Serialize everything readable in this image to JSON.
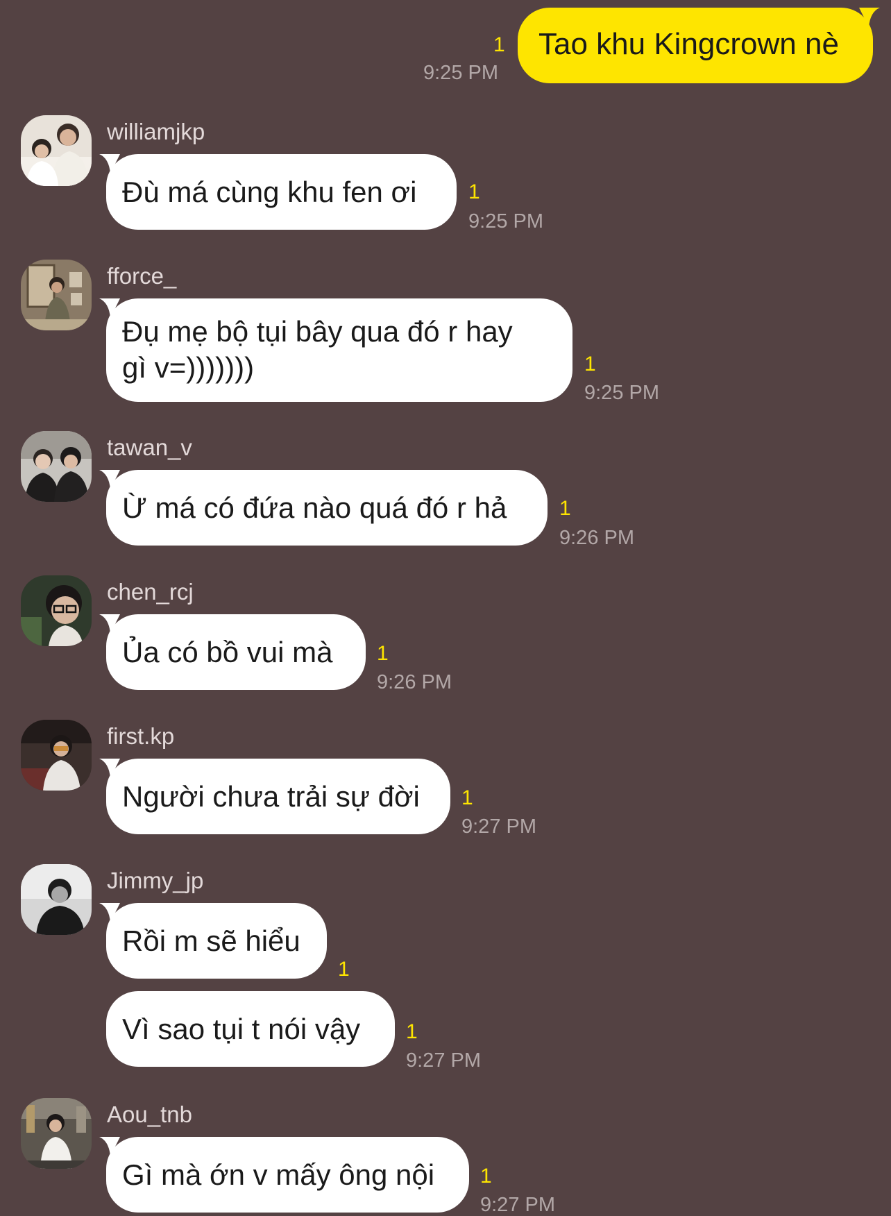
{
  "outgoing": {
    "text": "Tao khu Kingcrown nè",
    "unread": "1",
    "time": "9:25 PM"
  },
  "messages": [
    {
      "sender": "williamjkp",
      "lines": [
        "Đù má cùng khu fen ơi"
      ],
      "unread": "1",
      "time": "9:25 PM"
    },
    {
      "sender": "fforce_",
      "lines": [
        "Đụ mẹ bộ tụi bây qua đó r hay",
        "gì v=)))))))"
      ],
      "unread": "1",
      "time": "9:25 PM"
    },
    {
      "sender": "tawan_v",
      "lines": [
        "Ừ má có đứa nào quá đó r hả"
      ],
      "unread": "1",
      "time": "9:26 PM"
    },
    {
      "sender": "chen_rcj",
      "lines": [
        "Ủa có bồ vui mà"
      ],
      "unread": "1",
      "time": "9:26 PM"
    },
    {
      "sender": "first.kp",
      "lines": [
        "Người chưa trải sự đời"
      ],
      "unread": "1",
      "time": "9:27 PM"
    },
    {
      "sender": "Jimmy_jp",
      "lines": [
        "Rồi m sẽ hiểu"
      ],
      "unread": "1",
      "time": ""
    },
    {
      "sender": "",
      "lines": [
        "Vì sao tụi t nói vậy"
      ],
      "unread": "1",
      "time": "9:27 PM"
    },
    {
      "sender": "Aou_tnb",
      "lines": [
        "Gì mà ớn v mấy ông nội"
      ],
      "unread": "1",
      "time": "9:27 PM"
    }
  ],
  "colors": {
    "background": "#544243",
    "outgoing_bubble": "#FEE500",
    "incoming_bubble": "#FFFFFF",
    "unread_count": "#FEE500",
    "timestamp": "#B3A8A8",
    "sender_name": "#E3D9D9"
  }
}
